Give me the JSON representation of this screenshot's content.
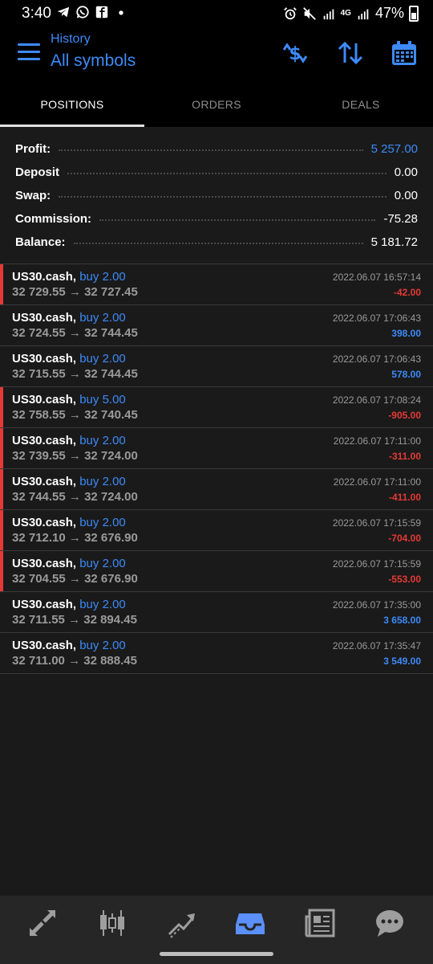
{
  "status_bar": {
    "time": "3:40",
    "battery": "47%",
    "network": "4G"
  },
  "header": {
    "subtitle": "History",
    "title": "All symbols"
  },
  "tabs": [
    {
      "label": "POSITIONS",
      "active": true
    },
    {
      "label": "ORDERS",
      "active": false
    },
    {
      "label": "DEALS",
      "active": false
    }
  ],
  "summary": {
    "profit_label": "Profit:",
    "profit": "5 257.00",
    "deposit_label": "Deposit",
    "deposit": "0.00",
    "swap_label": "Swap:",
    "swap": "0.00",
    "commission_label": "Commission:",
    "commission": "-75.28",
    "balance_label": "Balance:",
    "balance": "5 181.72"
  },
  "positions": [
    {
      "symbol": "US30.cash,",
      "side": "buy 2.00",
      "prices": "32 729.55 → 32 727.45",
      "time": "2022.06.07 16:57:14",
      "pnl": "-42.00",
      "loss": true
    },
    {
      "symbol": "US30.cash,",
      "side": "buy 2.00",
      "prices": "32 724.55 → 32 744.45",
      "time": "2022.06.07 17:06:43",
      "pnl": "398.00",
      "loss": false
    },
    {
      "symbol": "US30.cash,",
      "side": "buy 2.00",
      "prices": "32 715.55 → 32 744.45",
      "time": "2022.06.07 17:06:43",
      "pnl": "578.00",
      "loss": false
    },
    {
      "symbol": "US30.cash,",
      "side": "buy 5.00",
      "prices": "32 758.55 → 32 740.45",
      "time": "2022.06.07 17:08:24",
      "pnl": "-905.00",
      "loss": true
    },
    {
      "symbol": "US30.cash,",
      "side": "buy 2.00",
      "prices": "32 739.55 → 32 724.00",
      "time": "2022.06.07 17:11:00",
      "pnl": "-311.00",
      "loss": true
    },
    {
      "symbol": "US30.cash,",
      "side": "buy 2.00",
      "prices": "32 744.55 → 32 724.00",
      "time": "2022.06.07 17:11:00",
      "pnl": "-411.00",
      "loss": true
    },
    {
      "symbol": "US30.cash,",
      "side": "buy 2.00",
      "prices": "32 712.10 → 32 676.90",
      "time": "2022.06.07 17:15:59",
      "pnl": "-704.00",
      "loss": true
    },
    {
      "symbol": "US30.cash,",
      "side": "buy 2.00",
      "prices": "32 704.55 → 32 676.90",
      "time": "2022.06.07 17:15:59",
      "pnl": "-553.00",
      "loss": true
    },
    {
      "symbol": "US30.cash,",
      "side": "buy 2.00",
      "prices": "32 711.55 → 32 894.45",
      "time": "2022.06.07 17:35:00",
      "pnl": "3 658.00",
      "loss": false
    },
    {
      "symbol": "US30.cash,",
      "side": "buy 2.00",
      "prices": "32 711.00 → 32 888.45",
      "time": "2022.06.07 17:35:47",
      "pnl": "3 549.00",
      "loss": false
    }
  ],
  "bottom_nav": [
    {
      "icon": "quotes-icon",
      "active": false
    },
    {
      "icon": "chart-icon",
      "active": false
    },
    {
      "icon": "trade-icon",
      "active": false
    },
    {
      "icon": "history-icon",
      "active": true
    },
    {
      "icon": "news-icon",
      "active": false
    },
    {
      "icon": "chat-icon",
      "active": false
    }
  ],
  "colors": {
    "accent": "#3d8af7",
    "loss": "#e53935",
    "background": "#1a1a1a",
    "header": "#000000"
  }
}
